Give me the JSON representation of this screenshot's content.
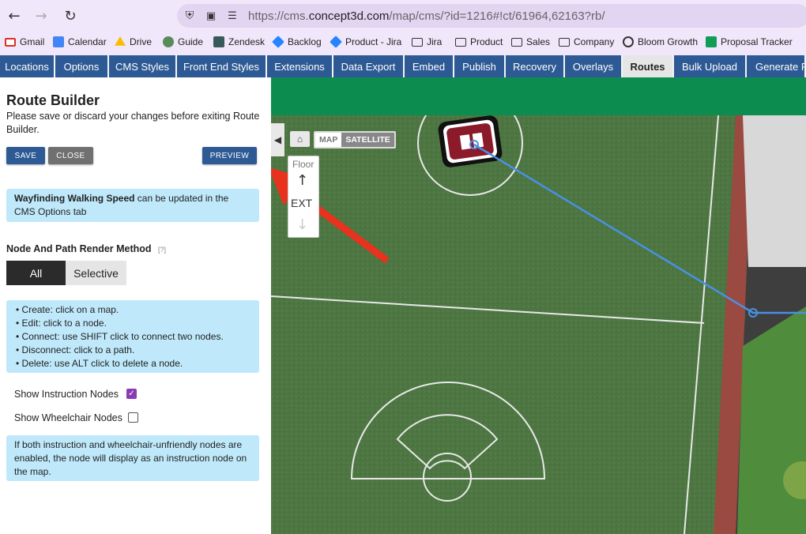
{
  "browser": {
    "url_prefix": "https://cms.",
    "url_domain": "concept3d.com",
    "url_path": "/map/cms/?id=1216#!ct/61964,62163?rb/",
    "bookmarks": [
      "Gmail",
      "Calendar",
      "Drive",
      "Guide",
      "Zendesk",
      "Backlog",
      "Product - Jira",
      "Jira",
      "Product",
      "Sales",
      "Company",
      "Bloom Growth",
      "Proposal Tracker"
    ]
  },
  "tabs": [
    "Locations",
    "Options",
    "CMS Styles",
    "Front End Styles",
    "Extensions",
    "Data Export",
    "Embed",
    "Publish",
    "Recovery",
    "Overlays",
    "Routes",
    "Bulk Upload",
    "Generate P"
  ],
  "active_tab": "Routes",
  "panel": {
    "title": "Route Builder",
    "subtitle": "Please save or discard your changes before exiting Route Builder.",
    "save_label": "SAVE",
    "close_label": "CLOSE",
    "preview_label": "PREVIEW",
    "speed_bold": "Wayfinding Walking Speed",
    "speed_rest": " can be updated in the CMS Options tab",
    "render_label": "Node And Path Render Method",
    "render_help": "[?]",
    "seg_all": "All",
    "seg_selective": "Selective",
    "instructions": [
      "Create: click on a map.",
      "Edit: click to a node.",
      "Connect: use SHIFT click to connect two nodes.",
      "Disconnect: click to a path.",
      "Delete: use ALT click to delete a node."
    ],
    "show_instruction_label": "Show Instruction Nodes",
    "show_instruction_checked": true,
    "show_wheelchair_label": "Show Wheelchair Nodes",
    "show_wheelchair_checked": false,
    "note": "If both instruction and wheelchair-unfriendly nodes are enabled, the node will display as an instruction node on the map."
  },
  "map": {
    "map_label": "MAP",
    "satellite_label": "SATELLITE",
    "floor_label": "Floor",
    "floor_value": "EXT"
  },
  "colors": {
    "accent": "#2d5a94",
    "info_bg": "#bfe9fb",
    "header_green": "#0d8c4f",
    "route": "#4a90e2",
    "arrow": "#e8321e"
  }
}
